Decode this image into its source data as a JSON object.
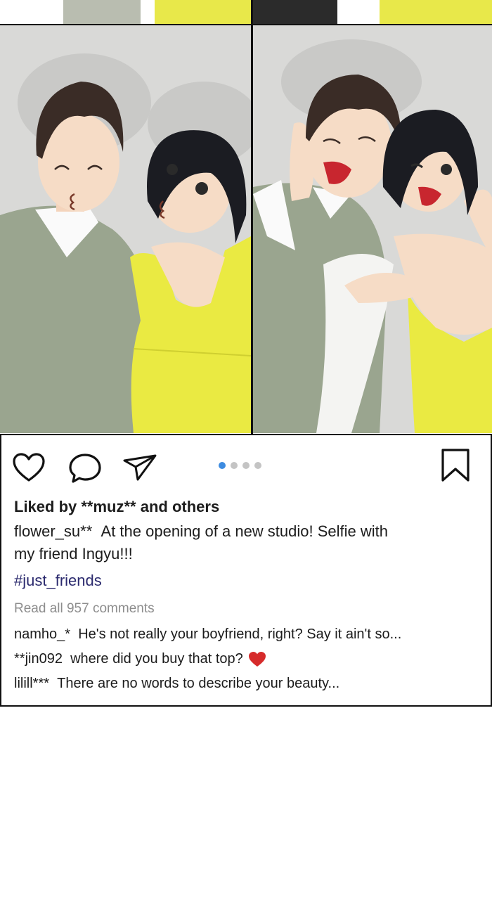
{
  "post": {
    "liked_by": "Liked by **muz** and others",
    "caption_user": "flower_su**",
    "caption_line1": "At the opening of a new studio! Selfie with",
    "caption_line2": "my friend Ingyu!!!",
    "hashtag": "#just_friends",
    "comments_link": "Read all 957 comments",
    "comments": [
      {
        "user": "namho_*",
        "text": "He's not really your boyfriend, right? Say it ain't so..."
      },
      {
        "user": "**jin092",
        "text": "where did you buy that top?"
      },
      {
        "user": "lilill***",
        "text": "There are no words to describe your beauty..."
      }
    ]
  },
  "carousel": {
    "count": 4,
    "active": 1
  },
  "icons": {
    "like": "heart-icon",
    "comment": "comment-bubble-icon",
    "share": "paper-plane-icon",
    "save": "bookmark-icon",
    "emoji": "red-heart-emoji"
  },
  "colors": {
    "active_dot": "#3d8be0",
    "hashtag": "#2b2a6e",
    "muted": "#8d8d8d",
    "heart_emoji": "#d62b2b"
  }
}
